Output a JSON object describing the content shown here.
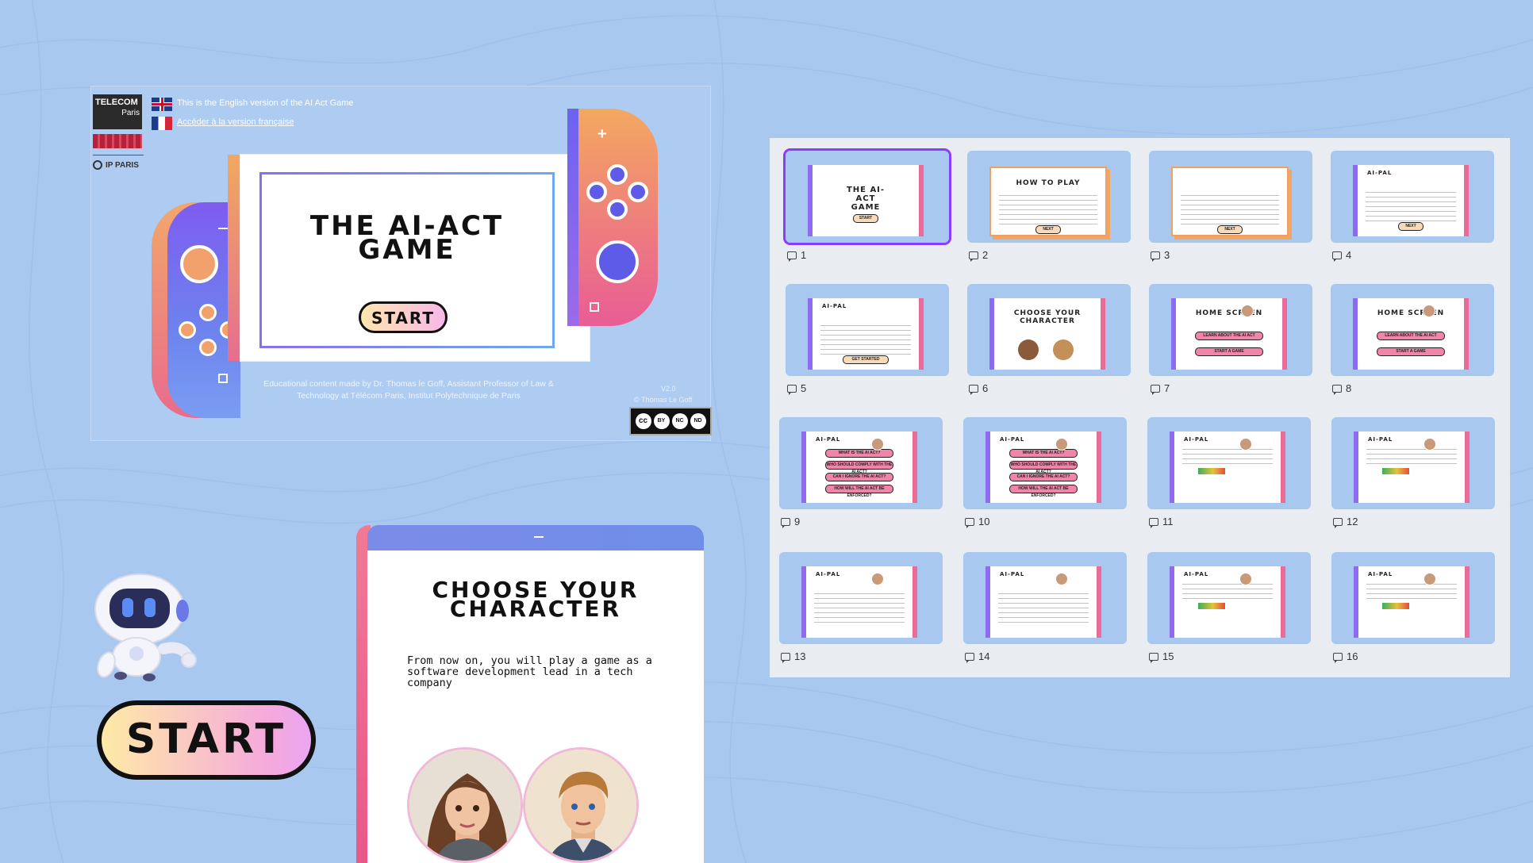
{
  "title_slide": {
    "logo_top": "TELECOM",
    "logo_sub": "Paris",
    "ip_paris": "IP PARIS",
    "english_note": "This is the English version of the AI Act Game",
    "french_link": "Accéder à la version française",
    "game_title_line1": "THE AI-ACT",
    "game_title_line2": "GAME",
    "start_label": "START",
    "credit_line1": "Educational content made by Dr. Thomas le Goff, Assistant Professor of Law &",
    "credit_line2": "Technology at Télécom Paris, Institut Polytechnique de Paris",
    "version": "V2.0",
    "copyright": "© Thomas Le Goff",
    "license_labels": [
      "BY",
      "NC",
      "ND"
    ]
  },
  "bottom_left": {
    "start_label": "START"
  },
  "choose_card": {
    "title_line1": "CHOOSE YOUR",
    "title_line2": "CHARACTER",
    "body": "From now on, you will play a game as a software development lead in a tech company",
    "avatars": [
      "female-character",
      "male-character"
    ]
  },
  "slides": [
    {
      "number": "1",
      "kind": "title",
      "heading": "THE AI-ACT GAME",
      "button": "START",
      "selected": true
    },
    {
      "number": "2",
      "kind": "text",
      "heading": "HOW TO PLAY",
      "button": "NEXT"
    },
    {
      "number": "3",
      "kind": "text",
      "heading": "",
      "button": "NEXT"
    },
    {
      "number": "4",
      "kind": "pal",
      "heading": "AI-PAL",
      "button": "NEXT"
    },
    {
      "number": "5",
      "kind": "pal",
      "heading": "AI-PAL",
      "button": "GET STARTED"
    },
    {
      "number": "6",
      "kind": "choose",
      "heading": "CHOOSE YOUR CHARACTER"
    },
    {
      "number": "7",
      "kind": "home",
      "heading": "HOME SCREEN",
      "pills": [
        "LEARN ABOUT THE AI ACT",
        "START A GAME"
      ]
    },
    {
      "number": "8",
      "kind": "home",
      "heading": "HOME SCREEN",
      "pills": [
        "LEARN ABOUT THE AI ACT",
        "START A GAME"
      ]
    },
    {
      "number": "9",
      "kind": "menu",
      "heading": "AI-PAL",
      "pills": [
        "WHAT IS THE AI ACT?",
        "WHO SHOULD COMPLY WITH THE AI ACT?",
        "CAN I IGNORE THE AI ACT?",
        "HOW WILL THE AI ACT BE ENFORCED?"
      ]
    },
    {
      "number": "10",
      "kind": "menu",
      "heading": "AI-PAL",
      "pills": [
        "WHAT IS THE AI ACT?",
        "WHO SHOULD COMPLY WITH THE AI ACT?",
        "CAN I IGNORE THE AI ACT?",
        "HOW WILL THE AI ACT BE ENFORCED?"
      ]
    },
    {
      "number": "11",
      "kind": "risk",
      "heading": "AI-PAL"
    },
    {
      "number": "12",
      "kind": "risk",
      "heading": "AI-PAL"
    },
    {
      "number": "13",
      "kind": "notes",
      "heading": "AI-PAL"
    },
    {
      "number": "14",
      "kind": "notes",
      "heading": "AI-PAL"
    },
    {
      "number": "15",
      "kind": "risk",
      "heading": "AI-PAL"
    },
    {
      "number": "16",
      "kind": "risk",
      "heading": "AI-PAL"
    }
  ],
  "colors": {
    "background": "#a9c8f0",
    "purple": "#7e5cf0",
    "orange": "#f2a76b",
    "pink": "#e96b8d",
    "panel": "#e9ecf1",
    "selected_outline": "#8b3dff"
  }
}
